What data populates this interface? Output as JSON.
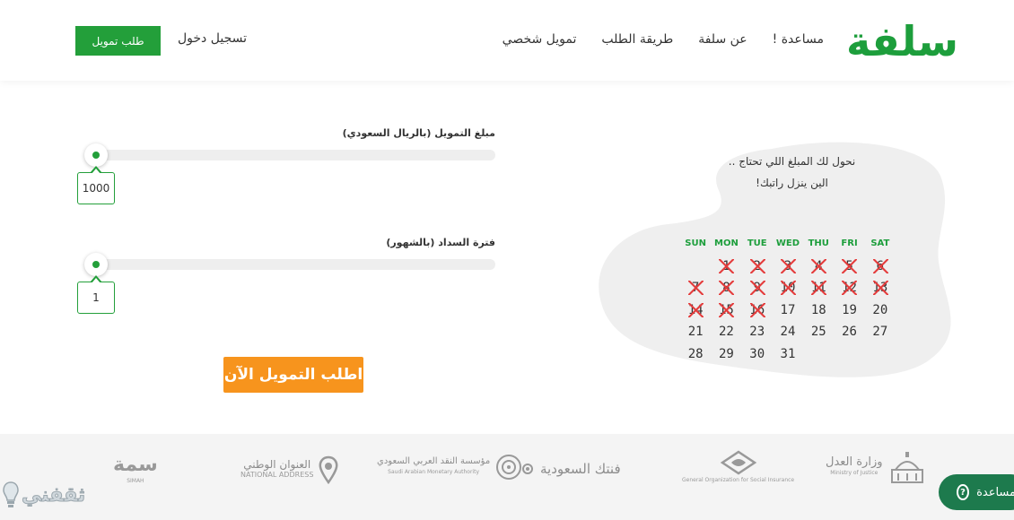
{
  "brand": {
    "logo": "سلفة",
    "accent": "#1d9e3c",
    "orange": "#f7941d"
  },
  "nav": {
    "items": [
      "تمويل شخصي",
      "طريقة الطلب",
      "عن سلفة",
      "مساعدة !"
    ],
    "login": "تسجيل دخول",
    "request_button": "طلب تمويل"
  },
  "card": {
    "line1": "نحول لك المبلغ اللي تحتاج ..",
    "line2": "الين ينزل راتبك!",
    "days": [
      "SUN",
      "MON",
      "TUE",
      "WED",
      "THU",
      "FRI",
      "SAT"
    ],
    "weeks": [
      [
        {
          "d": "",
          "x": false
        },
        {
          "d": "1",
          "x": true
        },
        {
          "d": "2",
          "x": true
        },
        {
          "d": "3",
          "x": true
        },
        {
          "d": "4",
          "x": true
        },
        {
          "d": "5",
          "x": true
        },
        {
          "d": "6",
          "x": true
        }
      ],
      [
        {
          "d": "7",
          "x": true
        },
        {
          "d": "8",
          "x": true
        },
        {
          "d": "9",
          "x": true
        },
        {
          "d": "10",
          "x": true
        },
        {
          "d": "11",
          "x": true
        },
        {
          "d": "12",
          "x": true
        },
        {
          "d": "13",
          "x": true
        }
      ],
      [
        {
          "d": "14",
          "x": true
        },
        {
          "d": "15",
          "x": true
        },
        {
          "d": "16",
          "x": true
        },
        {
          "d": "17",
          "x": false
        },
        {
          "d": "18",
          "x": false
        },
        {
          "d": "19",
          "x": false
        },
        {
          "d": "20",
          "x": false
        }
      ],
      [
        {
          "d": "21",
          "x": false
        },
        {
          "d": "22",
          "x": false
        },
        {
          "d": "23",
          "x": false
        },
        {
          "d": "24",
          "x": false
        },
        {
          "d": "25",
          "x": false
        },
        {
          "d": "26",
          "x": false
        },
        {
          "d": "27",
          "x": false
        }
      ],
      [
        {
          "d": "28",
          "x": false
        },
        {
          "d": "29",
          "x": false
        },
        {
          "d": "30",
          "x": false
        },
        {
          "d": "31",
          "x": false
        },
        {
          "d": "",
          "x": false
        },
        {
          "d": "",
          "x": false
        },
        {
          "d": "",
          "x": false
        }
      ]
    ]
  },
  "form": {
    "amount_label": "مبلغ التمويل (بالريال السعودي)",
    "amount_value": "1000",
    "period_label": "فترة السداد (بالشهور)",
    "period_value": "1",
    "submit": "اطلب التمويل الآن"
  },
  "partners": {
    "justice_main": "وزارة العدل",
    "justice_sub": "Ministry of Justice",
    "social_sub": "General Organization for Social Insurance",
    "fintech": "فنتك السعودية",
    "sama_main": "مؤسسة النقد العربي السعودي",
    "sama_sub": "Saudi Arabian Monetary Authority",
    "address_main": "العنوان الوطني",
    "address_sub": "NATIONAL ADDRESS",
    "simah_main": "سمة",
    "simah_sub": "SIMAH"
  },
  "help": {
    "label": "مساعدة"
  },
  "watermark": "ثقفني"
}
